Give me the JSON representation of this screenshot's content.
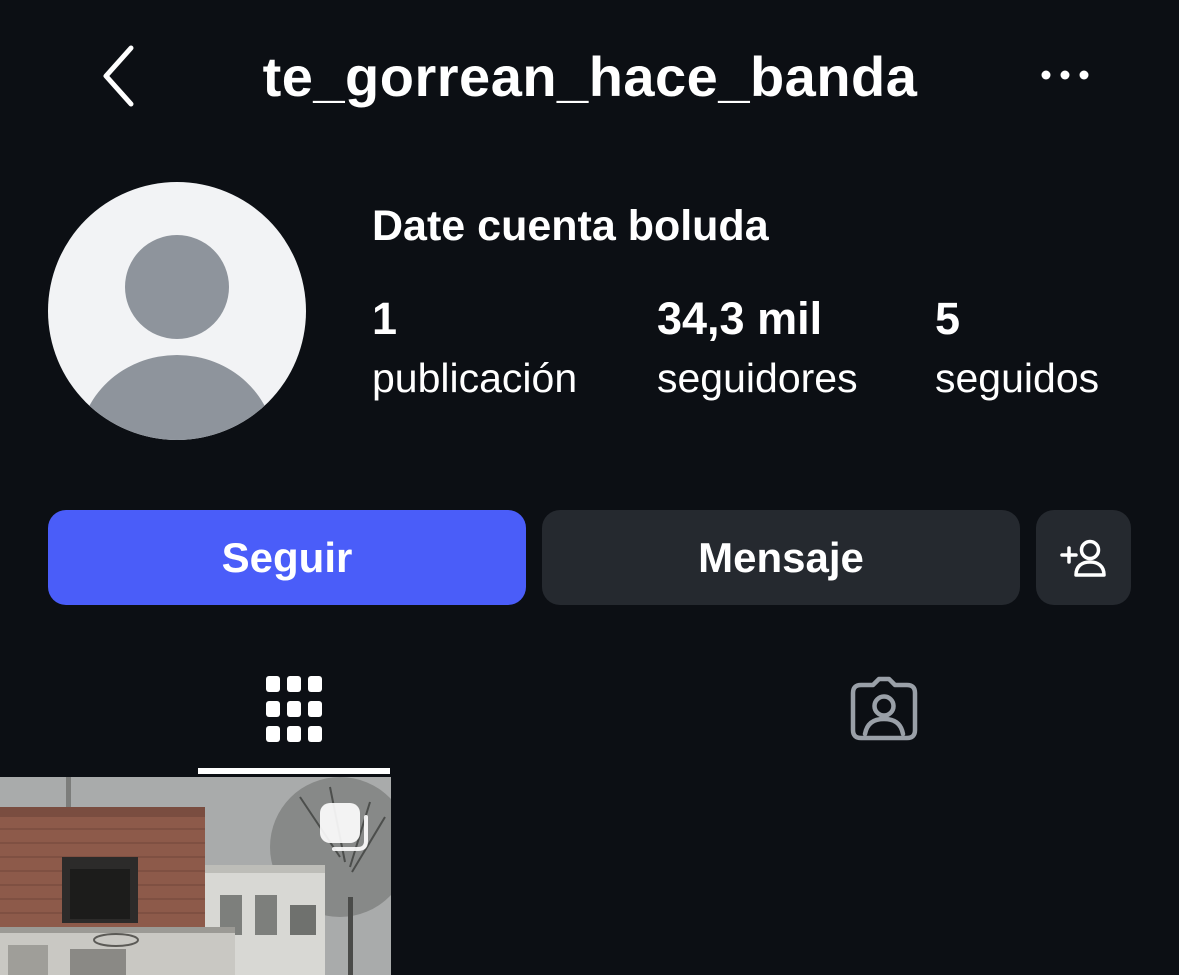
{
  "header": {
    "username": "te_gorrean_hace_banda"
  },
  "profile": {
    "display_name": "Date cuenta boluda",
    "stats": {
      "posts": {
        "value": "1",
        "label": "publicación"
      },
      "followers": {
        "value": "34,3 mil",
        "label": "seguidores"
      },
      "following": {
        "value": "5",
        "label": "seguidos"
      }
    }
  },
  "actions": {
    "follow_label": "Seguir",
    "message_label": "Mensaje"
  },
  "icons": {
    "back": "chevron-left-icon",
    "more": "more-horizontal-icon",
    "add_user": "add-user-icon",
    "grid": "grid-icon",
    "tagged": "tagged-icon",
    "carousel": "carousel-icon"
  },
  "colors": {
    "background": "#0c0f14",
    "follow_button": "#4a5df9",
    "secondary_button": "#25292f",
    "avatar_bg": "#f2f3f5",
    "avatar_figure": "#8e949c"
  }
}
